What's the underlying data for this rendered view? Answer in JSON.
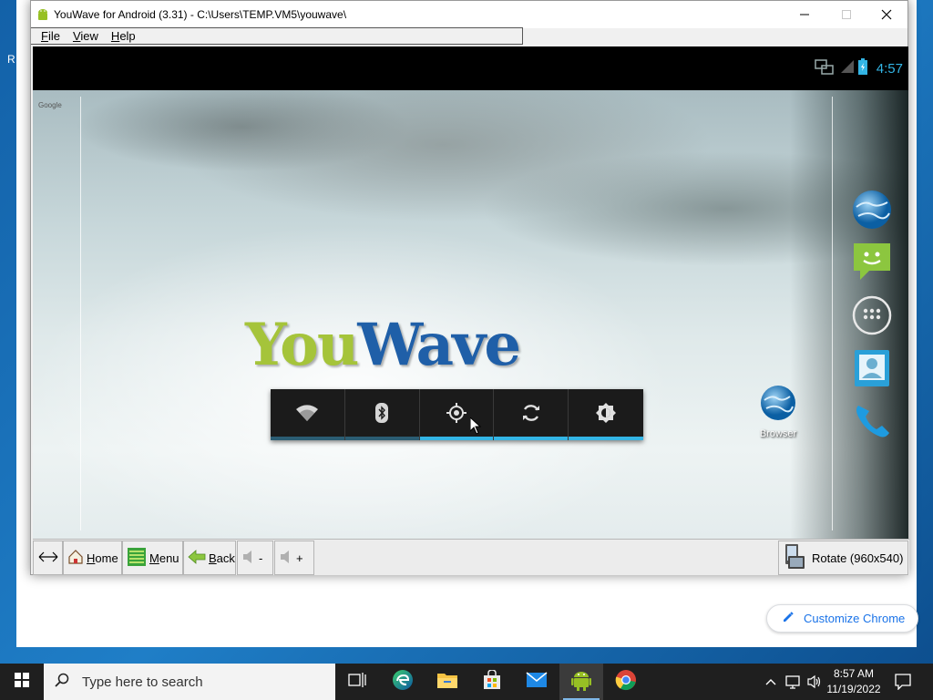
{
  "window": {
    "title": "YouWave for Android (3.31) - C:\\Users\\TEMP.VM5\\youwave\\",
    "menu": [
      "File",
      "View",
      "Help"
    ]
  },
  "android": {
    "status_time": "4:57",
    "clock_color": "#33b5e5",
    "google_label": "Google",
    "logo_part1": "You",
    "logo_part2": "Wave",
    "power_widget": [
      {
        "name": "wifi",
        "icon": "wifi-icon",
        "indicator_on": false
      },
      {
        "name": "bluetooth",
        "icon": "bluetooth-icon",
        "indicator_on": false
      },
      {
        "name": "gps",
        "icon": "gps-icon",
        "indicator_on": true
      },
      {
        "name": "sync",
        "icon": "sync-icon",
        "indicator_on": true
      },
      {
        "name": "brightness",
        "icon": "brightness-icon",
        "indicator_on": true
      }
    ],
    "indicator_on_color": "#33b5e5",
    "indicator_off_color": "#2b5d73",
    "browser_shortcut_label": "Browser",
    "dock": [
      "browser-globe-icon",
      "messaging-icon",
      "app-drawer-icon",
      "contacts-icon",
      "phone-icon"
    ]
  },
  "toolbar": {
    "home_label": "Home",
    "menu_label": "Menu",
    "back_label": "Back",
    "vol_down_label": "-",
    "vol_up_label": "+",
    "rotate_label": "Rotate (960x540)"
  },
  "chrome": {
    "customize_label": "Customize Chrome",
    "accent": "#1a73e8"
  },
  "taskbar": {
    "search_placeholder": "Type here to search",
    "apps": [
      "task-view-icon",
      "edge-icon",
      "file-explorer-icon",
      "store-icon",
      "mail-icon",
      "youwave-icon",
      "chrome-icon"
    ],
    "active_app": "youwave-icon",
    "time": "8:57 AM",
    "date": "11/19/2022"
  }
}
